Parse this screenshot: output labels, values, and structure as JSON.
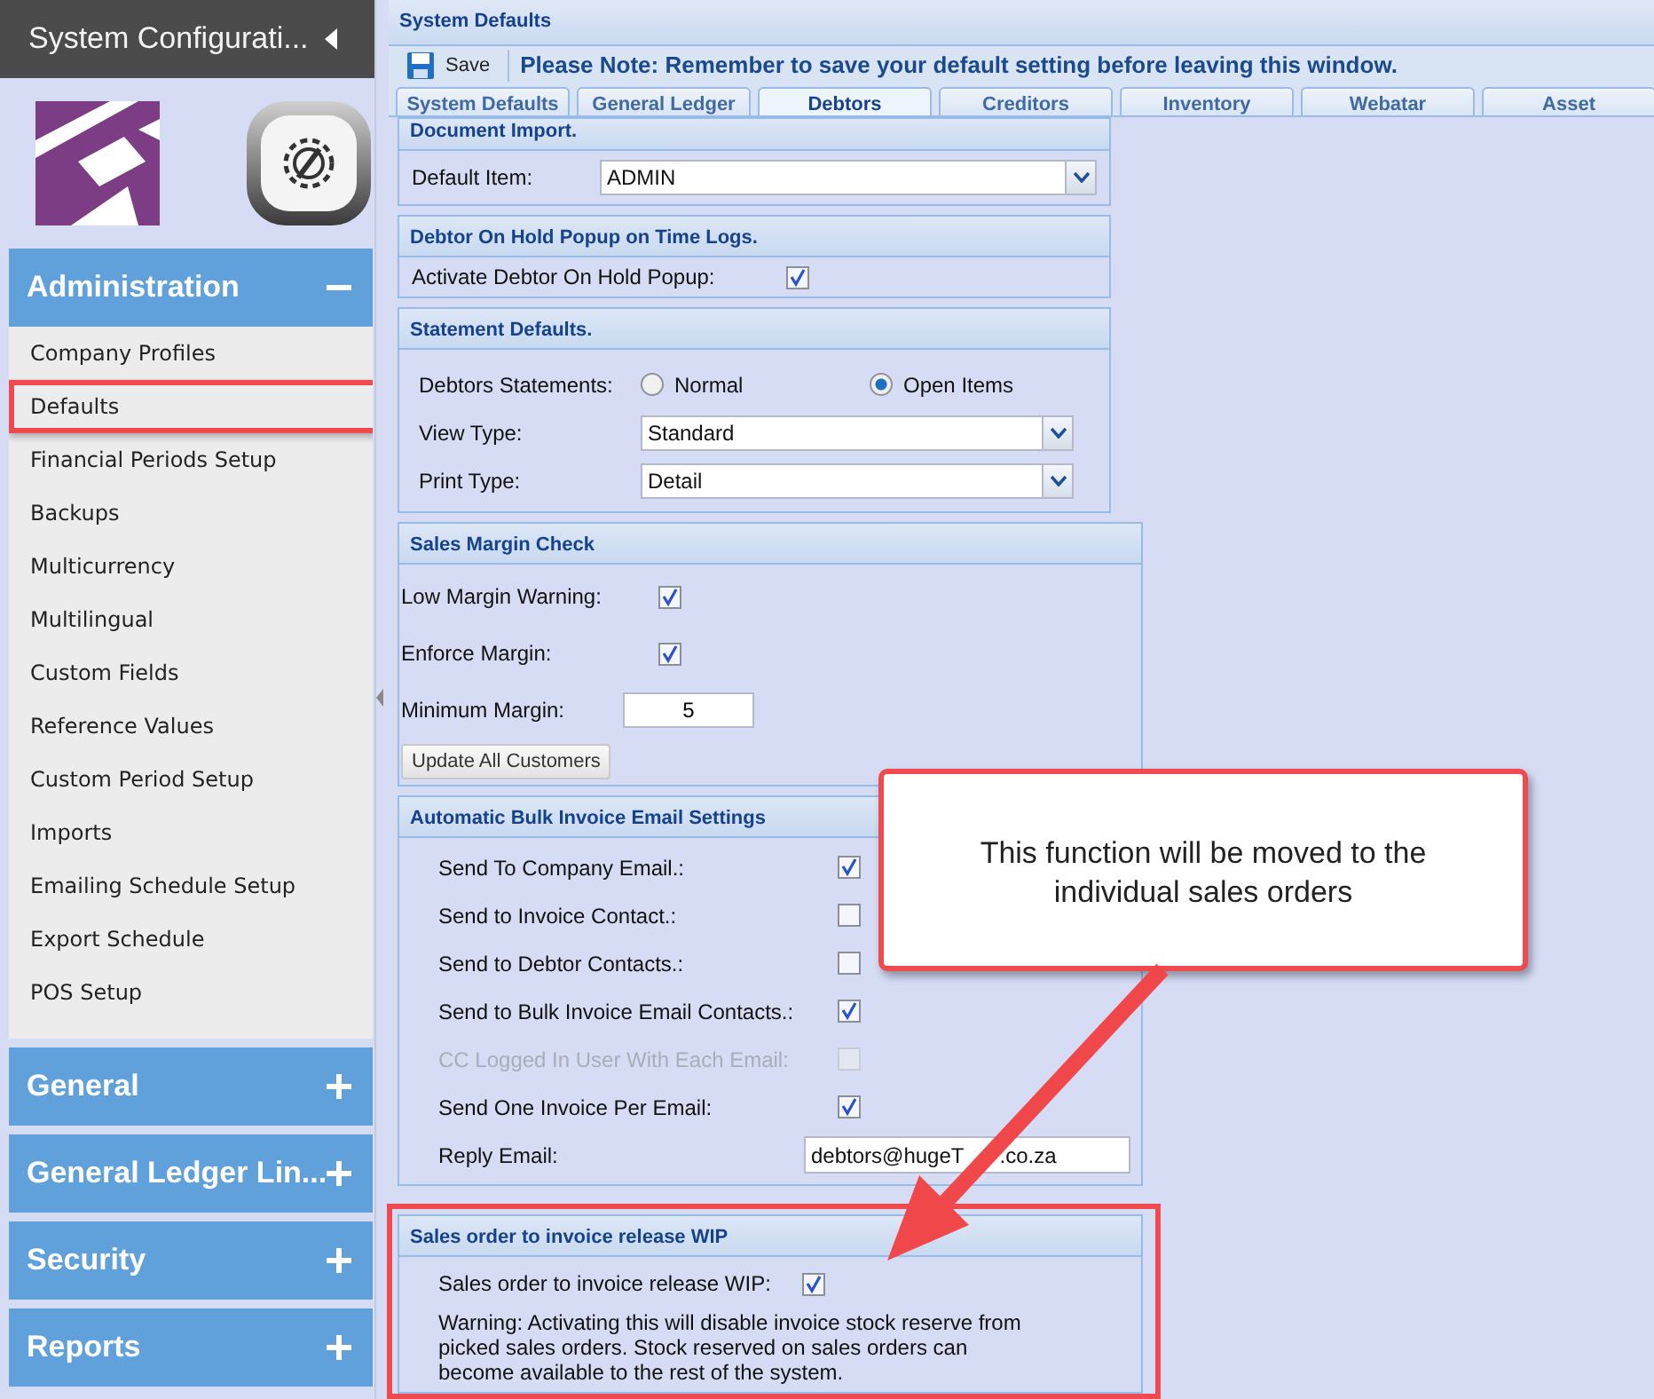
{
  "sidebar": {
    "title": "System Configurati...",
    "sections": [
      {
        "title": "Administration",
        "expanded": true,
        "items": [
          {
            "label": "Company Profiles",
            "annotated": false
          },
          {
            "label": "Defaults",
            "annotated": true
          },
          {
            "label": "Financial Periods Setup",
            "annotated": false
          },
          {
            "label": "Backups",
            "annotated": false
          },
          {
            "label": "Multicurrency",
            "annotated": false
          },
          {
            "label": "Multilingual",
            "annotated": false
          },
          {
            "label": "Custom Fields",
            "annotated": false
          },
          {
            "label": "Reference Values",
            "annotated": false
          },
          {
            "label": "Custom Period Setup",
            "annotated": false
          },
          {
            "label": "Imports",
            "annotated": false
          },
          {
            "label": "Emailing Schedule Setup",
            "annotated": false
          },
          {
            "label": "Export Schedule",
            "annotated": false
          },
          {
            "label": "POS Setup",
            "annotated": false
          }
        ]
      },
      {
        "title": "General",
        "expanded": false
      },
      {
        "title": "General Ledger Lin...",
        "expanded": false
      },
      {
        "title": "Security",
        "expanded": false
      },
      {
        "title": "Reports",
        "expanded": false
      }
    ]
  },
  "window": {
    "title": "System Defaults"
  },
  "toolbar": {
    "save": "Save",
    "note": "Please Note: Remember to save your default setting before leaving this window."
  },
  "tabs": [
    {
      "label": "System Defaults",
      "selected": false
    },
    {
      "label": "General Ledger",
      "selected": false
    },
    {
      "label": "Debtors",
      "selected": true
    },
    {
      "label": "Creditors",
      "selected": false
    },
    {
      "label": "Inventory",
      "selected": false
    },
    {
      "label": "Webatar",
      "selected": false
    },
    {
      "label": "Asset",
      "selected": false
    }
  ],
  "panels": [
    {
      "title": "Document Import.",
      "wide": false,
      "annotated": false,
      "rows": [
        {
          "kind": "select",
          "label": "Default Item:",
          "value": "ADMIN"
        }
      ]
    },
    {
      "title": "Debtor On Hold Popup on Time Logs.",
      "wide": false,
      "annotated": false,
      "rows": [
        {
          "kind": "checkbox",
          "label": "Activate Debtor On Hold Popup:",
          "checked": true,
          "disabled": false
        }
      ]
    },
    {
      "title": "Statement Defaults.",
      "wide": false,
      "annotated": false,
      "rows": [
        {
          "kind": "radio",
          "label": "Debtors Statements:",
          "options": [
            {
              "label": "Normal",
              "selected": false
            },
            {
              "label": "Open Items",
              "selected": true
            }
          ]
        },
        {
          "kind": "select",
          "label": "View Type:",
          "value": "Standard"
        },
        {
          "kind": "select",
          "label": "Print Type:",
          "value": "Detail"
        }
      ]
    },
    {
      "title": "Sales Margin Check",
      "wide": true,
      "annotated": false,
      "rows": [
        {
          "kind": "checkbox",
          "label": "Low Margin Warning:",
          "checked": true,
          "disabled": false
        },
        {
          "kind": "checkbox",
          "label": "Enforce Margin:",
          "checked": true,
          "disabled": false
        },
        {
          "kind": "number",
          "label": "Minimum Margin:",
          "value": "5"
        },
        {
          "kind": "button",
          "label": "Update All Customers"
        }
      ]
    },
    {
      "title": "Automatic Bulk Invoice Email Settings",
      "wide": true,
      "annotated": false,
      "rows": [
        {
          "kind": "checkbox",
          "label": "Send To Company Email.:",
          "checked": true,
          "disabled": false
        },
        {
          "kind": "checkbox",
          "label": "Send to Invoice Contact.:",
          "checked": false,
          "disabled": false
        },
        {
          "kind": "checkbox",
          "label": "Send to Debtor Contacts.:",
          "checked": false,
          "disabled": false
        },
        {
          "kind": "checkbox",
          "label": "Send to Bulk Invoice Email Contacts.:",
          "checked": true,
          "disabled": false
        },
        {
          "kind": "checkbox",
          "label": "CC Logged In User With Each Email:",
          "checked": false,
          "disabled": true
        },
        {
          "kind": "checkbox",
          "label": "Send One Invoice Per Email:",
          "checked": true,
          "disabled": false
        },
        {
          "kind": "email",
          "label": "Reply Email:",
          "value_start": "debtors@hugeT",
          "value_end": ".co.za"
        }
      ]
    },
    {
      "title": "Sales order to invoice release WIP",
      "wide": true,
      "annotated": true,
      "rows": [
        {
          "kind": "checkbox",
          "label": "Sales order to invoice release WIP:",
          "checked": true,
          "disabled": false
        },
        {
          "kind": "note",
          "text": "Warning: Activating this will disable invoice stock reserve from picked sales orders. Stock reserved on sales orders can become available to the rest of the system."
        }
      ]
    }
  ],
  "callout": {
    "text": "This function will be moved to the individual sales orders"
  }
}
